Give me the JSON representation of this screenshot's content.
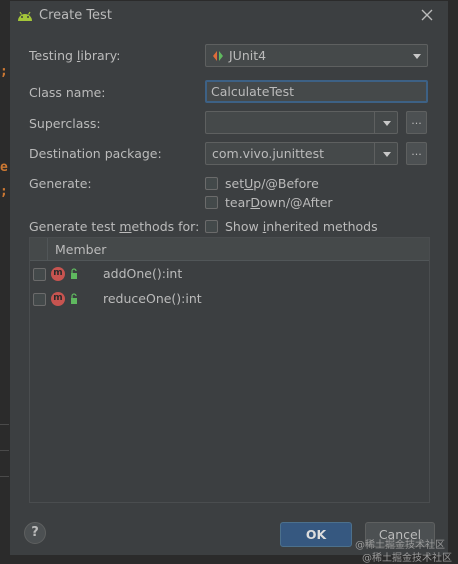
{
  "window": {
    "title": "Create Test"
  },
  "form": {
    "testing_library": {
      "label_pre": "Testing ",
      "label_u": "l",
      "label_post": "ibrary:",
      "value": "JUnit4"
    },
    "class_name": {
      "label": "Class name:",
      "value": "CalculateTest"
    },
    "superclass": {
      "label": "Superclass:",
      "value": "",
      "browse_label": "..."
    },
    "destination_package": {
      "label": "Destination package:",
      "value": "com.vivo.junittest",
      "browse_label": "..."
    },
    "generate": {
      "label": "Generate:",
      "options": [
        {
          "pre": "set",
          "u": "U",
          "post": "p/@Before",
          "checked": false
        },
        {
          "pre": "tear",
          "u": "D",
          "post": "own/@After",
          "checked": false
        }
      ]
    },
    "generate_methods": {
      "label_pre": "Generate test ",
      "label_u": "m",
      "label_post": "ethods for:"
    },
    "show_inherited": {
      "pre": "Show ",
      "u": "i",
      "post": "nherited methods",
      "checked": false
    }
  },
  "members_table": {
    "header": "Member",
    "rows": [
      {
        "name": "addOne():int",
        "checked": false,
        "icon": "m"
      },
      {
        "name": "reduceOne():int",
        "checked": false,
        "icon": "m"
      }
    ]
  },
  "buttons": {
    "help": "?",
    "ok": "OK",
    "cancel": "Cancel"
  },
  "background_code": {
    "chars": [
      ";",
      "e",
      ";"
    ]
  },
  "watermark": {
    "line1": "@稀土掘金技术社区",
    "line2": "@稀土掘金技术社区"
  },
  "colors": {
    "accent": "#365880",
    "focus": "#3d6185",
    "method_icon": "#c75450",
    "android": "#a4c639"
  }
}
